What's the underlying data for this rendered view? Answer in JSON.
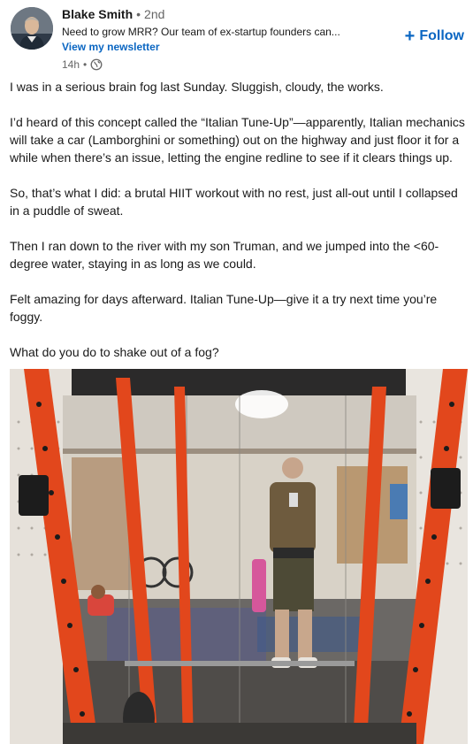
{
  "author": {
    "name": "Blake Smith",
    "separator": "•",
    "degree": "2nd",
    "headline": "Need to grow MRR? Our team of ex-startup founders can...",
    "newsletter_link": "View my newsletter",
    "time": "14h",
    "meta_separator": "•",
    "visibility_icon": "globe-icon"
  },
  "follow": {
    "plus": "+",
    "label": "Follow"
  },
  "post": {
    "paragraphs": [
      "I was in a serious brain fog last Sunday. Sluggish, cloudy, the works.",
      "I’d heard of this concept called the “Italian Tune-Up”—apparently, Italian mechanics will take a car (Lamborghini or something) out on the highway and just floor it for a while when there’s an issue, letting the engine redline to see if it clears things up.",
      "So, that’s what I did: a brutal HIIT workout with no rest, just all-out until I collapsed in a puddle of sweat.",
      "Then I ran down to the river with my son Truman, and we jumped into the <60-degree water, staying in as long as we could.",
      "Felt amazing for days afterward. Italian Tune-Up—give it a try next time you’re foggy.",
      "What do you do to shake out of a fog?"
    ]
  },
  "colors": {
    "link_blue": "#0a66c2",
    "text": "#191919",
    "muted": "#666666",
    "rack_orange": "#e2471c"
  }
}
